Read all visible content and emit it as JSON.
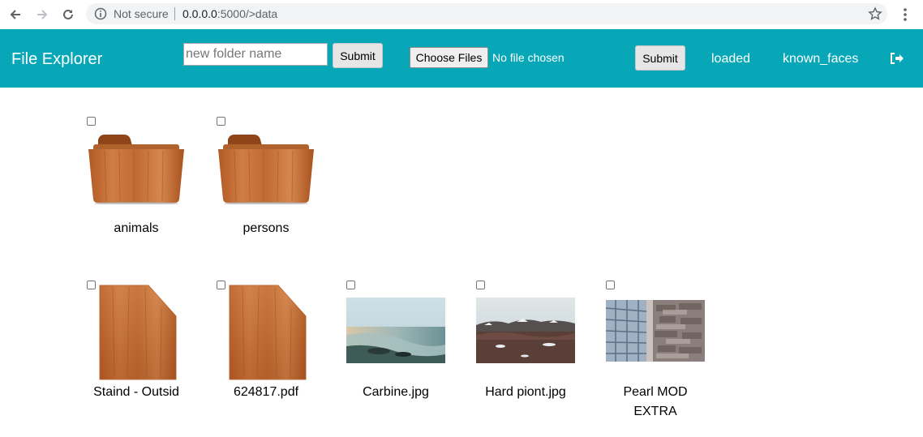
{
  "browser": {
    "security_label": "Not secure",
    "url_host": "0.0.0.0",
    "url_rest": ":5000/>data",
    "icons": [
      "back-arrow-icon",
      "forward-arrow-icon",
      "reload-icon",
      "info-icon",
      "star-icon",
      "menu-dots-icon"
    ]
  },
  "navbar": {
    "brand": "File Explorer",
    "folder_placeholder": "new folder name",
    "folder_submit": "Submit",
    "choose_files": "Choose Files",
    "no_file": "No file chosen",
    "upload_submit": "Submit",
    "links": [
      "loaded",
      "known_faces"
    ],
    "logout_icon": "logout-icon",
    "background_color": "#07a7b7"
  },
  "folders": [
    {
      "name": "animals",
      "icon": "wood-folder-icon"
    },
    {
      "name": "persons",
      "icon": "wood-folder-icon"
    }
  ],
  "files": [
    {
      "name": "Staind - Outsid",
      "icon": "wood-file-icon"
    },
    {
      "name": "624817.pdf",
      "icon": "wood-file-icon"
    },
    {
      "name": "Carbine.jpg",
      "icon": "beach-thumbnail"
    },
    {
      "name": "Hard piont.jpg",
      "icon": "snowy-field-thumbnail"
    },
    {
      "name": "Pearl MOD EXTRA",
      "icon": "building-thumbnail"
    }
  ]
}
